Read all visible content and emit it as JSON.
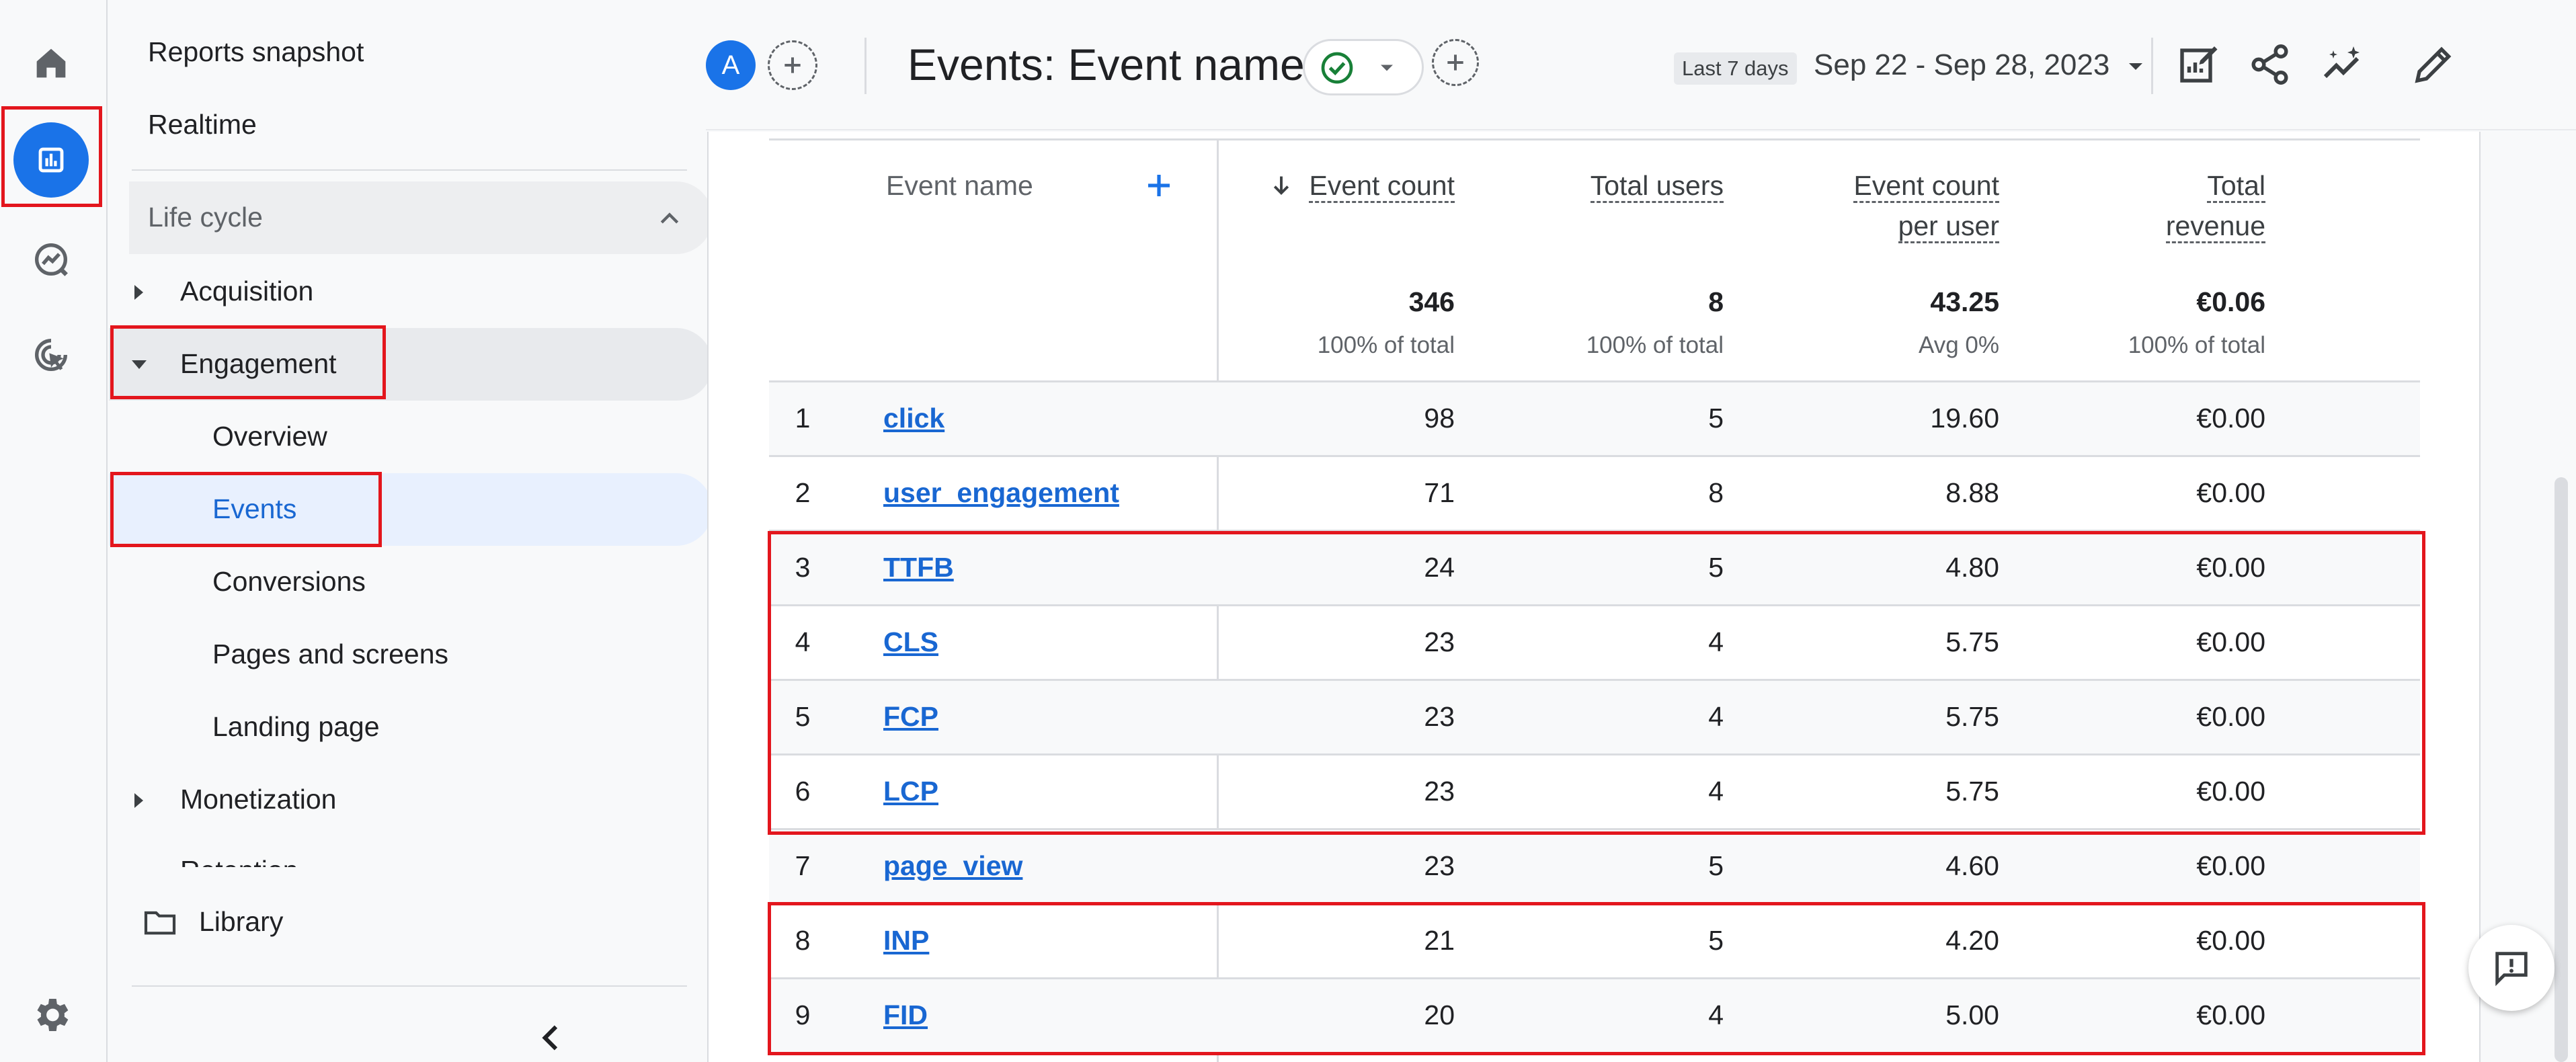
{
  "nav": {
    "reports_snapshot": "Reports snapshot",
    "realtime": "Realtime",
    "section": "Life cycle",
    "acquisition": "Acquisition",
    "engagement": "Engagement",
    "engagement_items": [
      "Overview",
      "Events",
      "Conversions",
      "Pages and screens",
      "Landing page"
    ],
    "monetization": "Monetization",
    "retention_partial": "Retention",
    "library": "Library"
  },
  "header": {
    "avatar_letter": "A",
    "title": "Events: Event name",
    "date_chip": "Last 7 days",
    "date_range": "Sep 22 - Sep 28, 2023"
  },
  "table": {
    "columns": {
      "event_name": "Event name",
      "event_count": "Event count",
      "total_users": "Total users",
      "per_user_1": "Event count",
      "per_user_2": "per user",
      "revenue_1": "Total",
      "revenue_2": "revenue"
    },
    "totals": {
      "event_count": "346",
      "event_count_pct": "100% of total",
      "total_users": "8",
      "total_users_pct": "100% of total",
      "per_user": "43.25",
      "per_user_pct": "Avg 0%",
      "revenue": "€0.06",
      "revenue_pct": "100% of total"
    },
    "rows": [
      {
        "idx": "1",
        "name": "click",
        "count": "98",
        "users": "5",
        "per_user": "19.60",
        "revenue": "€0.00"
      },
      {
        "idx": "2",
        "name": "user_engagement",
        "count": "71",
        "users": "8",
        "per_user": "8.88",
        "revenue": "€0.00"
      },
      {
        "idx": "3",
        "name": "TTFB",
        "count": "24",
        "users": "5",
        "per_user": "4.80",
        "revenue": "€0.00"
      },
      {
        "idx": "4",
        "name": "CLS",
        "count": "23",
        "users": "4",
        "per_user": "5.75",
        "revenue": "€0.00"
      },
      {
        "idx": "5",
        "name": "FCP",
        "count": "23",
        "users": "4",
        "per_user": "5.75",
        "revenue": "€0.00"
      },
      {
        "idx": "6",
        "name": "LCP",
        "count": "23",
        "users": "4",
        "per_user": "5.75",
        "revenue": "€0.00"
      },
      {
        "idx": "7",
        "name": "page_view",
        "count": "23",
        "users": "5",
        "per_user": "4.60",
        "revenue": "€0.00"
      },
      {
        "idx": "8",
        "name": "INP",
        "count": "21",
        "users": "5",
        "per_user": "4.20",
        "revenue": "€0.00"
      },
      {
        "idx": "9",
        "name": "FID",
        "count": "20",
        "users": "4",
        "per_user": "5.00",
        "revenue": "€0.00"
      }
    ]
  },
  "icons": [
    "home-icon",
    "reports-icon",
    "explore-icon",
    "advertising-icon",
    "settings-icon",
    "folder-icon",
    "chevron-up-icon",
    "chevron-left-icon",
    "add-icon",
    "check-circle-icon",
    "dropdown-arrow-icon",
    "edit-report-icon",
    "share-icon",
    "insights-icon",
    "pencil-icon",
    "sort-down-icon",
    "feedback-icon"
  ],
  "colors": {
    "accent": "#1a73e8",
    "link": "#1967d2",
    "highlight": "#e3161d",
    "selected_bg": "#e8f0fe",
    "check": "#188038"
  }
}
